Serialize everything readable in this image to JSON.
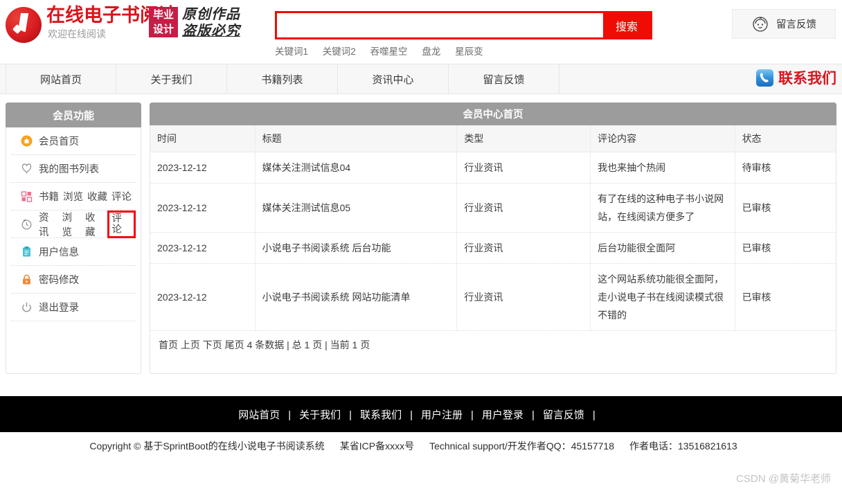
{
  "header": {
    "logo_title": "在线电子书阅读",
    "logo_sub": "欢迎在线阅读",
    "badge_line1": "毕业",
    "badge_line2": "设计",
    "calligraphy_line1": "原创作品",
    "calligraphy_line2": "盗版必究",
    "search": {
      "value": "",
      "placeholder": "",
      "button_label": "搜索",
      "keywords": [
        "关键词1",
        "关键词2",
        "吞噬星空",
        "盘龙",
        "星辰变"
      ]
    },
    "feedback_button": "留言反馈"
  },
  "nav": {
    "items": [
      "网站首页",
      "关于我们",
      "书籍列表",
      "资讯中心",
      "留言反馈"
    ],
    "contact_label": "联系我们"
  },
  "sidebar": {
    "title": "会员功能",
    "items": [
      {
        "icon": "home-icon",
        "label": "会员首页",
        "extra": []
      },
      {
        "icon": "heart-icon",
        "label": "我的图书列表",
        "extra": []
      },
      {
        "icon": "grid-icon",
        "label": "书籍",
        "extra": [
          "浏览",
          "收藏",
          "评论"
        ]
      },
      {
        "icon": "clock-icon",
        "label": "资讯",
        "extra": [
          "浏览",
          "收藏",
          "评论"
        ],
        "highlight": "评论"
      },
      {
        "icon": "clipboard-icon",
        "label": "用户信息",
        "extra": []
      },
      {
        "icon": "lock-icon",
        "label": "密码修改",
        "extra": []
      },
      {
        "icon": "power-icon",
        "label": "退出登录",
        "extra": []
      }
    ]
  },
  "panel": {
    "title": "会员中心首页",
    "columns": [
      "时间",
      "标题",
      "类型",
      "评论内容",
      "状态"
    ],
    "rows": [
      {
        "time": "2023-12-12",
        "title": "媒体关注测试信息04",
        "type": "行业资讯",
        "comment": "我也来抽个热闹",
        "status": "待审核",
        "status_pending": true
      },
      {
        "time": "2023-12-12",
        "title": "媒体关注测试信息05",
        "type": "行业资讯",
        "comment": "有了在线的这种电子书小说网站，在线阅读方便多了",
        "status": "已审核",
        "status_pending": false
      },
      {
        "time": "2023-12-12",
        "title": "小说电子书阅读系统 后台功能",
        "type": "行业资讯",
        "comment": "后台功能很全面阿",
        "status": "已审核",
        "status_pending": false
      },
      {
        "time": "2023-12-12",
        "title": "小说电子书阅读系统 网站功能清单",
        "type": "行业资讯",
        "comment": "这个网站系统功能很全面阿，走小说电子书在线阅读模式很不错的",
        "status": "已审核",
        "status_pending": false
      }
    ],
    "pager": {
      "first": "首页",
      "prev": "上页",
      "next": "下页",
      "last": "尾页",
      "summary": "4 条数据 | 总 1 页 | 当前 1 页"
    }
  },
  "footer": {
    "links": [
      "网站首页",
      "关于我们",
      "联系我们",
      "用户注册",
      "用户登录",
      "留言反馈"
    ],
    "copyright_main": "Copyright © 基于SprintBoot的在线小说电子书阅读系统",
    "copyright_icp": "某省ICP备xxxx号",
    "copyright_qq": "Technical support/开发作者QQ：45157718",
    "copyright_phone": "作者电话：13516821613",
    "watermark": "CSDN @黄菊华老师"
  },
  "colors": {
    "brand_red": "#d8151b",
    "search_red": "#f00c04",
    "badge_red": "#c41e47",
    "panel_gray": "#9c9c9c",
    "status_pending": "#e8323c",
    "highlight_box": "#f5000b"
  }
}
